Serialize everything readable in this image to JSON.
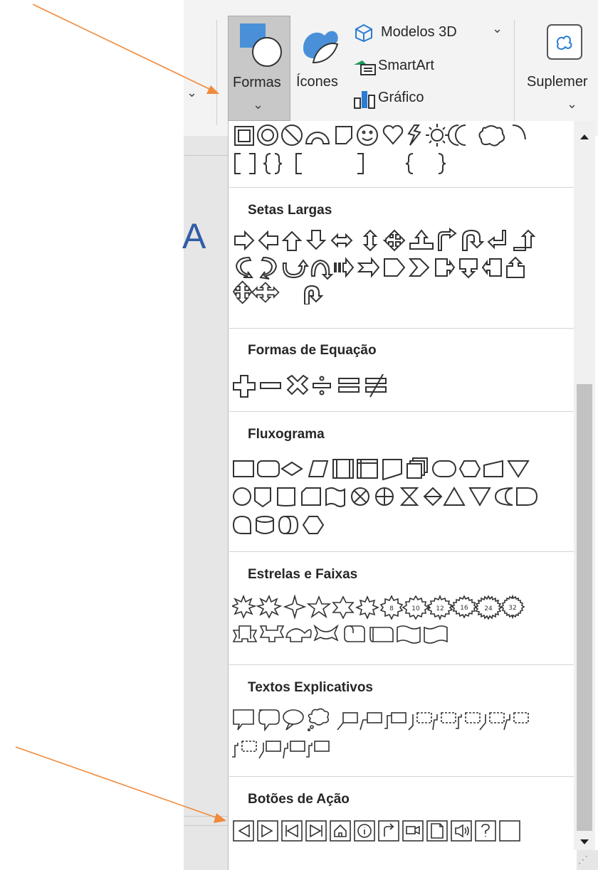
{
  "ribbon": {
    "formas_label": "Formas",
    "icones_label": "Ícones",
    "modelos3d_label": "Modelos 3D",
    "smartart_label": "SmartArt",
    "grafico_label": "Gráfico",
    "suplementos_label": "Suplemer"
  },
  "document": {
    "visible_letter": "A"
  },
  "shapes_panel": {
    "sections": [
      {
        "title": "Setas Largas"
      },
      {
        "title": "Formas de Equação"
      },
      {
        "title": "Fluxograma"
      },
      {
        "title": "Estrelas e Faixas"
      },
      {
        "title": "Textos Explicativos"
      },
      {
        "title": "Botões de Ação"
      }
    ]
  },
  "annotation": {
    "arrow_color": "#f08a3c"
  },
  "colors": {
    "ribbon_bg": "#f3f3f3",
    "selected_button": "#c8c8c8",
    "doc_text": "#2f5da7",
    "icon_blue": "#4a90d9"
  }
}
